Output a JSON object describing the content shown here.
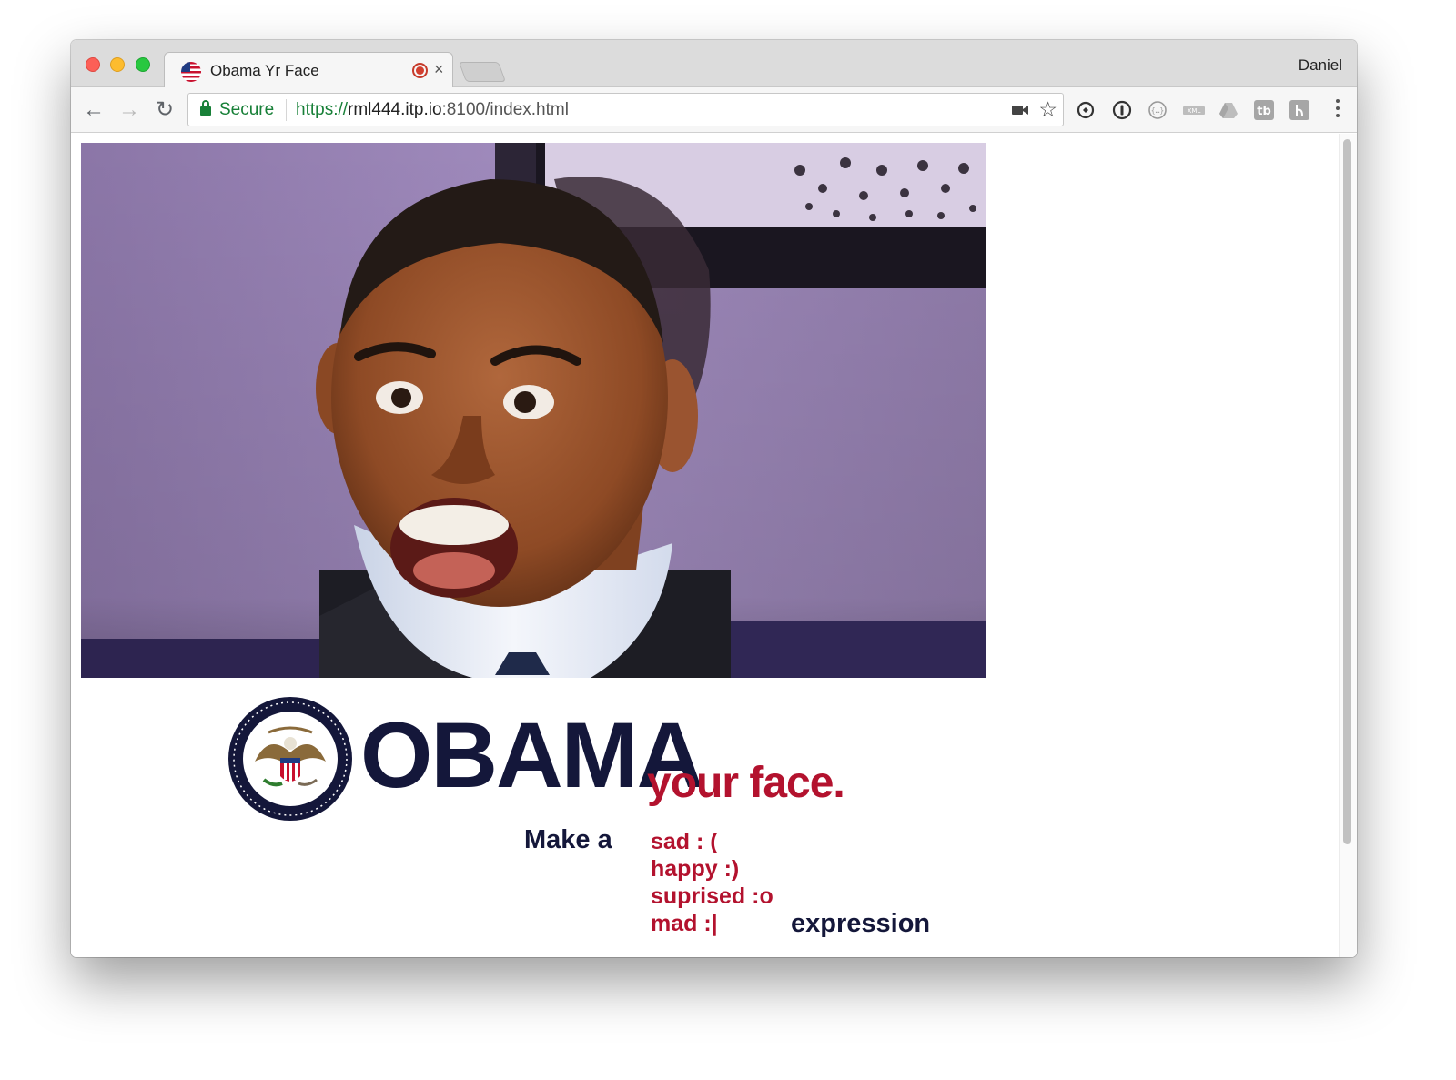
{
  "browser": {
    "tab_title": "Obama Yr Face",
    "tab_close": "×",
    "profile_name": "Daniel",
    "secure_label": "Secure",
    "url_scheme": "https://",
    "url_host": "rml444.itp.io",
    "url_rest": ":8100/index.html",
    "back_glyph": "←",
    "forward_glyph": "→",
    "reload_glyph": "↻",
    "star_glyph": "☆"
  },
  "icons": {
    "tab_favicon": "us-flag-icon",
    "recording": "recording-icon",
    "camera": "camera-icon",
    "bookmark": "star-icon",
    "extensions": [
      "sync-icon",
      "1password-icon",
      "json-viewer-icon",
      "xml-icon",
      "drive-icon",
      "tb-icon",
      "anchor-icon"
    ],
    "menu": "more-vert-icon"
  },
  "page": {
    "headline": "OBAMA",
    "tagline": "your face.",
    "make_a": "Make a",
    "expressions": [
      "sad  : (",
      "happy  :)",
      "suprised  :o",
      "mad  :|"
    ],
    "expression_word": "expression"
  },
  "colors": {
    "navy": "#14173a",
    "crimson": "#b3122e",
    "secure_green": "#188038",
    "purple_wall": "#9b88b6"
  }
}
